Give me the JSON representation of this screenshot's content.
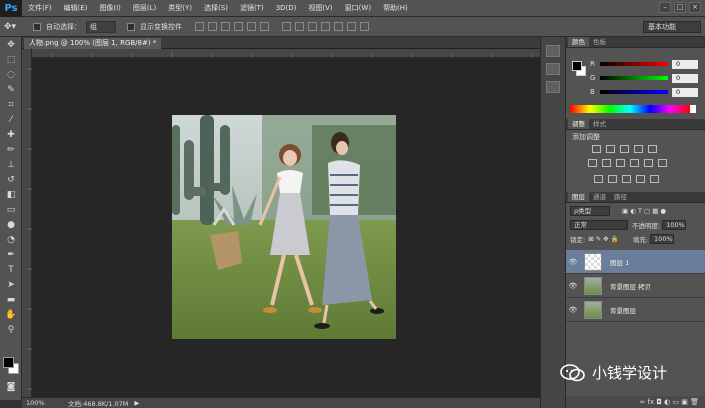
{
  "app": {
    "logo": "Ps",
    "workspace": "基本功能"
  },
  "menu": [
    "文件(F)",
    "编辑(E)",
    "图像(I)",
    "图层(L)",
    "类型(Y)",
    "选择(S)",
    "滤镜(T)",
    "3D(D)",
    "视图(V)",
    "窗口(W)",
    "帮助(H)"
  ],
  "window_buttons": [
    "–",
    "□",
    "×"
  ],
  "options": {
    "auto_select_label": "自动选择：",
    "auto_select_value": "组",
    "show_transform_label": "显示变换控件"
  },
  "document": {
    "tab_title": "人物.png @ 100% (图层 1, RGB/8#) *",
    "zoom": "100%",
    "doc_info": "文档:468.8K/1.07M"
  },
  "color_panel": {
    "tabs": [
      "颜色",
      "色板"
    ],
    "channels": [
      {
        "label": "R",
        "value": "0"
      },
      {
        "label": "G",
        "value": "0"
      },
      {
        "label": "B",
        "value": "0"
      }
    ]
  },
  "adjustments_panel": {
    "tabs": [
      "调整",
      "样式"
    ],
    "title": "添加调整"
  },
  "layers_panel": {
    "tabs": [
      "图层",
      "通道",
      "路径"
    ],
    "filter": "ρ类型",
    "blend_mode": "正常",
    "opacity_label": "不透明度:",
    "opacity_value": "100%",
    "lock_label": "锁定:",
    "fill_label": "填充:",
    "fill_value": "100%",
    "layers": [
      {
        "name": "图层 1",
        "selected": true
      },
      {
        "name": "背景图层 拷贝",
        "selected": false
      },
      {
        "name": "背景图层",
        "selected": false
      }
    ]
  },
  "watermark": "小钱学设计"
}
